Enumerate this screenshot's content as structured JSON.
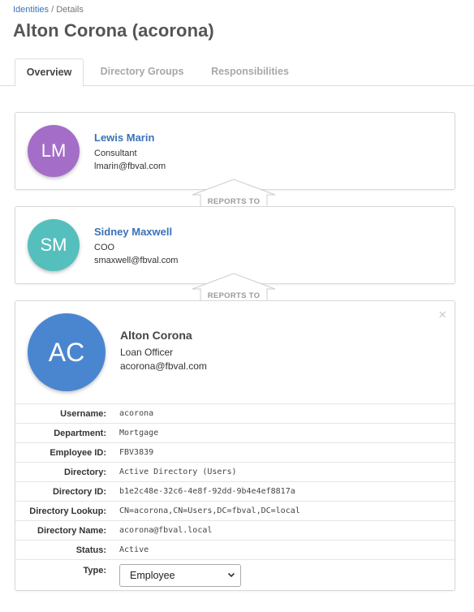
{
  "breadcrumb": {
    "root": "Identities",
    "sep": " / ",
    "current": "Details"
  },
  "page_title": "Alton Corona (acorona)",
  "tabs": [
    {
      "label": "Overview",
      "active": true
    },
    {
      "label": "Directory Groups",
      "active": false
    },
    {
      "label": "Responsibilities",
      "active": false
    }
  ],
  "chain": {
    "manager2": {
      "initials": "LM",
      "color": "#a46dc8",
      "name": "Lewis Marin",
      "title": "Consultant",
      "email": "lmarin@fbval.com"
    },
    "manager1": {
      "initials": "SM",
      "color": "#55bfbd",
      "name": "Sidney Maxwell",
      "title": "COO",
      "email": "smaxwell@fbval.com"
    },
    "reports_to_label": "REPORTS TO"
  },
  "identity": {
    "initials": "AC",
    "color": "#4a86d0",
    "name": "Alton Corona",
    "title": "Loan Officer",
    "email": "acorona@fbval.com",
    "close_icon": "×",
    "fields": [
      {
        "label": "Username:",
        "value": "acorona"
      },
      {
        "label": "Department:",
        "value": "Mortgage"
      },
      {
        "label": "Employee ID:",
        "value": "FBV3839"
      },
      {
        "label": "Directory:",
        "value": "Active Directory (Users)"
      },
      {
        "label": "Directory ID:",
        "value": "b1e2c48e-32c6-4e8f-92dd-9b4e4ef8817a"
      },
      {
        "label": "Directory Lookup:",
        "value": "CN=acorona,CN=Users,DC=fbval,DC=local"
      },
      {
        "label": "Directory Name:",
        "value": "acorona@fbval.local"
      },
      {
        "label": "Status:",
        "value": "Active"
      }
    ],
    "type": {
      "label": "Type:",
      "selected": "Employee"
    }
  }
}
